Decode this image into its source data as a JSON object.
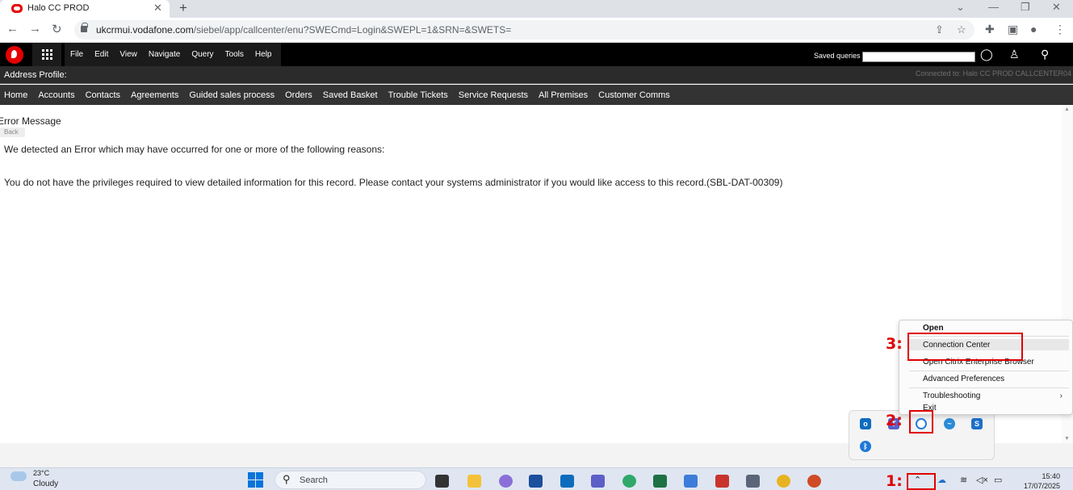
{
  "browser": {
    "tab_title": "Halo CC PROD",
    "tab_close": "✕",
    "new_tab": "+",
    "url_host": "ukcrmui.vodafone.com",
    "url_path": "/siebel/app/callcenter/enu?SWECmd=Login&SWEPL=1&SRN=&SWETS="
  },
  "siebel": {
    "menu": [
      "File",
      "Edit",
      "View",
      "Navigate",
      "Query",
      "Tools",
      "Help"
    ],
    "saved_queries_label": "Saved queries",
    "address_profile_label": "Address Profile:",
    "connected_text": "Connected to: Halo CC PROD CALLCENTER04",
    "screen_tabs": [
      "Home",
      "Accounts",
      "Contacts",
      "Agreements",
      "Guided sales process",
      "Orders",
      "Saved Basket",
      "Trouble Tickets",
      "Service Requests",
      "All Premises",
      "Customer Comms"
    ]
  },
  "content": {
    "title": "Error Message",
    "back_label": "Back",
    "line1": "We detected an Error which may have occurred for one or more of the following reasons:",
    "line2": "You do not have the privileges required to view detailed information for this record. Please contact your systems administrator if you would like access to this record.(SBL-DAT-00309)"
  },
  "context_menu": {
    "items": [
      "Open",
      "Connection Center",
      "Open Citrix Enterprise Browser",
      "Advanced Preferences",
      "Troubleshooting",
      "Exit"
    ],
    "submenu_chevron": "›"
  },
  "annotations": [
    "1:",
    "2:",
    "3:"
  ],
  "taskbar": {
    "weather_temp": "23°C",
    "weather_desc": "Cloudy",
    "search_label": "Search",
    "time": "15:40",
    "date": "17/07/2025"
  },
  "colors": {
    "vodafone_red": "#e60000",
    "annotation_red": "#e00000",
    "siebel_header": "#000000",
    "siebel_tabbar": "#333333"
  }
}
